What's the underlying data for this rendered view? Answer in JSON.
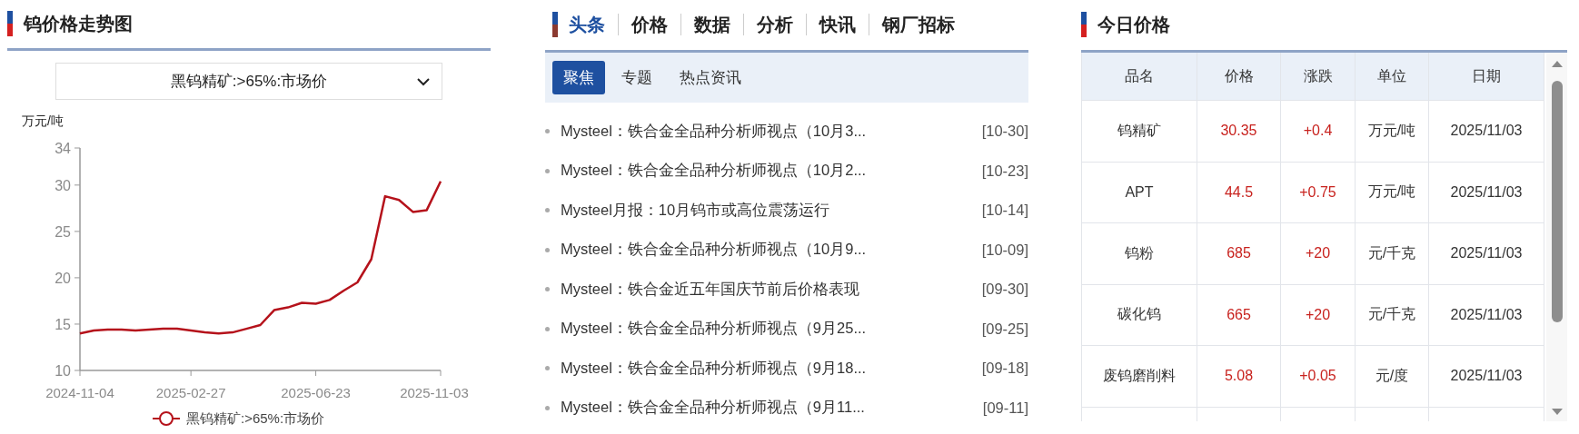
{
  "price_chart": {
    "title": "钨价格走势图",
    "selector": {
      "value": "黑钨精矿:>65%:市场价"
    },
    "chart_data": {
      "type": "line",
      "ylabel": "万元/吨",
      "categories": [
        "2024-11-04",
        null,
        null,
        null,
        null,
        null,
        null,
        null,
        "2025-02-27",
        null,
        null,
        null,
        null,
        null,
        null,
        null,
        null,
        "2025-06-23",
        null,
        null,
        null,
        null,
        null,
        null,
        null,
        null,
        "2025-11-03"
      ],
      "series": [
        {
          "name": "黑钨精矿:>65%:市场价",
          "color": "#b5121b",
          "values": [
            14.0,
            14.3,
            14.4,
            14.4,
            14.3,
            14.4,
            14.5,
            14.5,
            14.3,
            14.1,
            14.0,
            14.1,
            14.5,
            14.9,
            16.5,
            16.8,
            17.3,
            17.2,
            17.6,
            18.6,
            19.5,
            22.0,
            28.8,
            28.4,
            27.1,
            27.3,
            30.4
          ]
        }
      ],
      "ylim": [
        10,
        34
      ],
      "yticks": [
        10,
        15,
        20,
        25,
        30,
        34
      ]
    }
  },
  "news": {
    "tabs": [
      {
        "label": "头条",
        "selected": true
      },
      {
        "label": "价格",
        "selected": false
      },
      {
        "label": "数据",
        "selected": false
      },
      {
        "label": "分析",
        "selected": false
      },
      {
        "label": "快讯",
        "selected": false
      },
      {
        "label": "钢厂招标",
        "selected": false
      }
    ],
    "subtabs": [
      {
        "label": "聚焦",
        "selected": true
      },
      {
        "label": "专题",
        "selected": false
      },
      {
        "label": "热点资讯",
        "selected": false
      }
    ],
    "items": [
      {
        "title": "Mysteel：铁合金全品种分析师视点（10月3...",
        "date": "[10-30]"
      },
      {
        "title": "Mysteel：铁合金全品种分析师视点（10月2...",
        "date": "[10-23]"
      },
      {
        "title": "Mysteel月报：10月钨市或高位震荡运行",
        "date": "[10-14]"
      },
      {
        "title": "Mysteel：铁合金全品种分析师视点（10月9...",
        "date": "[10-09]"
      },
      {
        "title": "Mysteel：铁合金近五年国庆节前后价格表现",
        "date": "[09-30]"
      },
      {
        "title": "Mysteel：铁合金全品种分析师视点（9月25...",
        "date": "[09-25]"
      },
      {
        "title": "Mysteel：铁合金全品种分析师视点（9月18...",
        "date": "[09-18]"
      },
      {
        "title": "Mysteel：铁合金全品种分析师视点（9月11...",
        "date": "[09-11]"
      }
    ]
  },
  "today_prices": {
    "title": "今日价格",
    "columns": [
      "品名",
      "价格",
      "涨跌",
      "单位",
      "日期"
    ],
    "rows": [
      {
        "name": "钨精矿",
        "price": "30.35",
        "change": "+0.4",
        "unit": "万元/吨",
        "date": "2025/11/03"
      },
      {
        "name": "APT",
        "price": "44.5",
        "change": "+0.75",
        "unit": "万元/吨",
        "date": "2025/11/03"
      },
      {
        "name": "钨粉",
        "price": "685",
        "change": "+20",
        "unit": "元/千克",
        "date": "2025/11/03"
      },
      {
        "name": "碳化钨",
        "price": "665",
        "change": "+20",
        "unit": "元/千克",
        "date": "2025/11/03"
      },
      {
        "name": "废钨磨削料",
        "price": "5.08",
        "change": "+0.05",
        "unit": "元/度",
        "date": "2025/11/03"
      }
    ]
  }
}
